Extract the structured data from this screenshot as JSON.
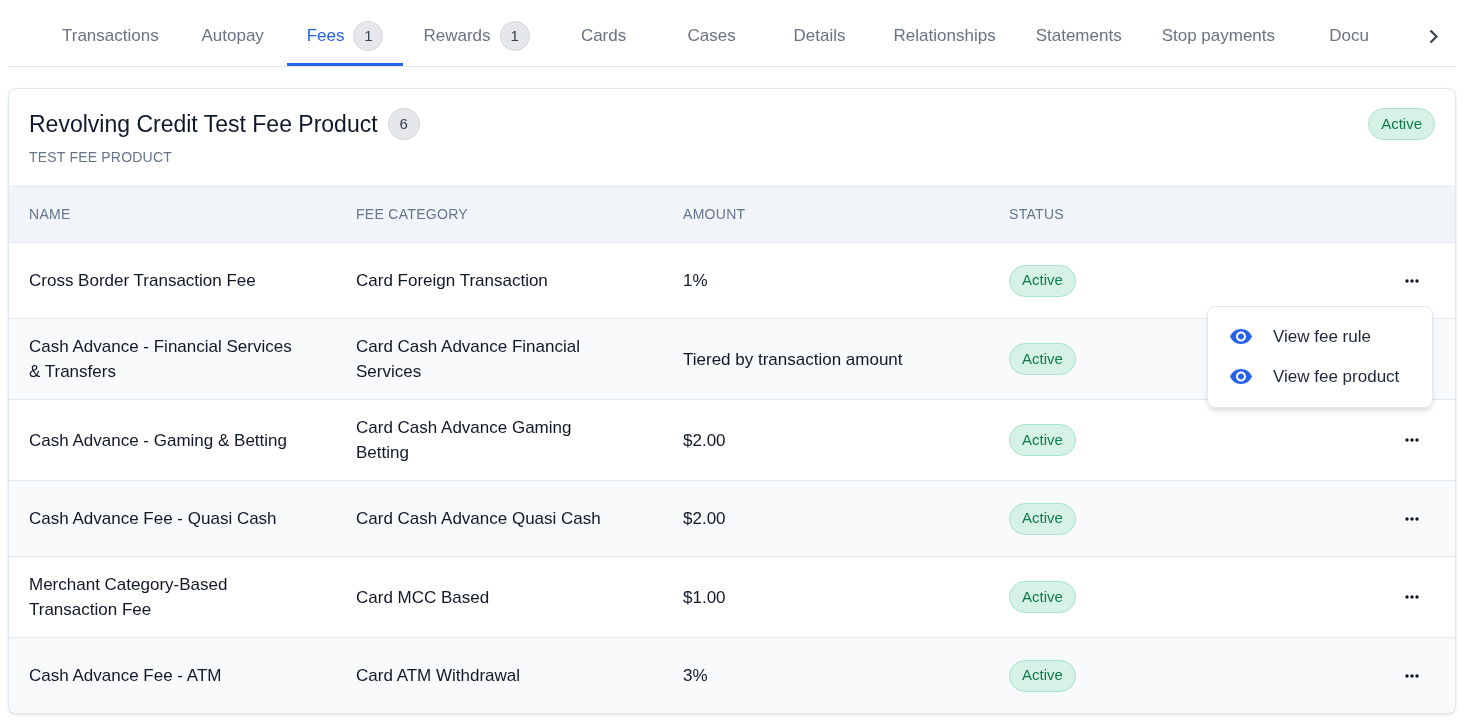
{
  "tabs": [
    {
      "label": "Transactions",
      "selected": false
    },
    {
      "label": "Autopay",
      "selected": false
    },
    {
      "label": "Fees",
      "count": "1",
      "selected": true
    },
    {
      "label": "Rewards",
      "count": "1",
      "selected": false
    },
    {
      "label": "Cards",
      "selected": false
    },
    {
      "label": "Cases",
      "selected": false
    },
    {
      "label": "Details",
      "selected": false
    },
    {
      "label": "Relationships",
      "selected": false
    },
    {
      "label": "Statements",
      "selected": false
    },
    {
      "label": "Stop payments",
      "selected": false
    },
    {
      "label": "Docu",
      "selected": false
    }
  ],
  "fee_product": {
    "title": "Revolving Credit Test Fee Product",
    "count": "6",
    "subtitle": "TEST FEE PRODUCT",
    "status": "Active"
  },
  "table": {
    "columns": [
      "NAME",
      "FEE CATEGORY",
      "AMOUNT",
      "STATUS"
    ],
    "rows": [
      {
        "name": "Cross Border Transaction Fee",
        "fee_category": "Card Foreign Transaction",
        "amount": "1%",
        "status": "Active",
        "menu_open": true
      },
      {
        "name": "Cash Advance - Financial Services & Transfers",
        "fee_category": "Card Cash Advance Financial Services",
        "amount": "Tiered by transaction amount",
        "status": "Active",
        "menu_open": false
      },
      {
        "name": "Cash Advance - Gaming & Betting",
        "fee_category": "Card Cash Advance Gaming Betting",
        "amount": "$2.00",
        "status": "Active",
        "menu_open": false
      },
      {
        "name": "Cash Advance Fee - Quasi Cash",
        "fee_category": "Card Cash Advance Quasi Cash",
        "amount": "$2.00",
        "status": "Active",
        "menu_open": false
      },
      {
        "name": "Merchant Category-Based Transaction Fee",
        "fee_category": "Card MCC Based",
        "amount": "$1.00",
        "status": "Active",
        "menu_open": false
      },
      {
        "name": "Cash Advance Fee - ATM",
        "fee_category": "Card ATM Withdrawal",
        "amount": "3%",
        "status": "Active",
        "menu_open": false
      }
    ],
    "row_menu": {
      "items": [
        {
          "label": "View fee rule"
        },
        {
          "label": "View fee product"
        }
      ]
    }
  }
}
